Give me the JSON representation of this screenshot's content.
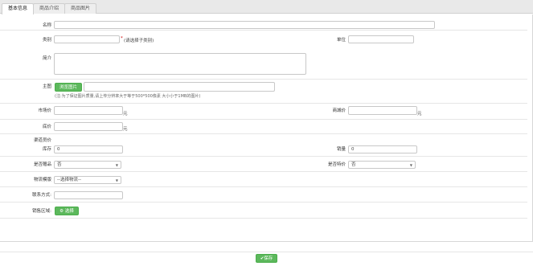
{
  "tabs": [
    {
      "label": "基本信息"
    },
    {
      "label": "商品介绍"
    },
    {
      "label": "商品图片"
    }
  ],
  "form": {
    "name_label": "名称",
    "category_label": "类别",
    "category_value": "",
    "category_hint": "(请选择子类别)",
    "category_required": "*",
    "unit_label": "单位",
    "intro_label": "简介",
    "main_image_label": "主图",
    "browse_button": "浏览图片",
    "image_hint": "(注:为了保证图片质量,请上传分辨率大于等于500*500像素 大小小于1MB的图片)",
    "market_price_label": "市场价",
    "market_price_unit": "元",
    "mall_price_label": "商城价",
    "mall_price_unit": "元",
    "base_price_label": "底价",
    "base_price_unit": "元",
    "member_price_label": "渠道员价",
    "stock_label": "库存",
    "stock_value": "0",
    "sales_label": "销量",
    "sales_value": "0",
    "gift_label": "是否赠品",
    "gift_value": "否",
    "special_label": "是否特价",
    "special_value": "否",
    "logistics_label": "物流模版",
    "logistics_value": "--选择物流--",
    "contact_label": "联系方式:",
    "region_label": "销售区域:",
    "region_button": "选择"
  },
  "footer": {
    "save_button": "保存"
  },
  "colors": {
    "accent_green": "#5cb85c"
  }
}
